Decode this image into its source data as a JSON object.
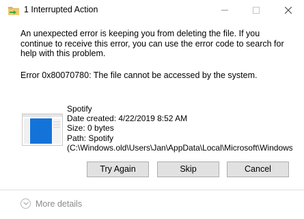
{
  "window": {
    "title": "1 Interrupted Action",
    "controls": {
      "minimize": "minimize",
      "maximize": "maximize",
      "close": "close"
    }
  },
  "message": {
    "main": "An unexpected error is keeping you from deleting the file. If you continue to receive this error, you can use the error code to search for help with this problem.",
    "error": "Error 0x80070780: The file cannot be accessed by the system."
  },
  "file": {
    "name": "Spotify",
    "date_created": "Date created: 4/22/2019 8:52 AM",
    "size": "Size: 0 bytes",
    "path": "Path: Spotify",
    "full_path": "(C:\\Windows.old\\Users\\Jan\\AppData\\Local\\Microsoft\\Windows"
  },
  "buttons": {
    "try_again": "Try Again",
    "skip": "Skip",
    "cancel": "Cancel"
  },
  "footer": {
    "more_details": "More details"
  },
  "colors": {
    "accent": "#0078d7",
    "button_bg": "#e1e1e1",
    "muted_text": "#8a8a8a"
  },
  "icons": {
    "app": "file-move-icon",
    "file": "file-thumbnail-icon",
    "expand": "chevron-down-icon"
  }
}
